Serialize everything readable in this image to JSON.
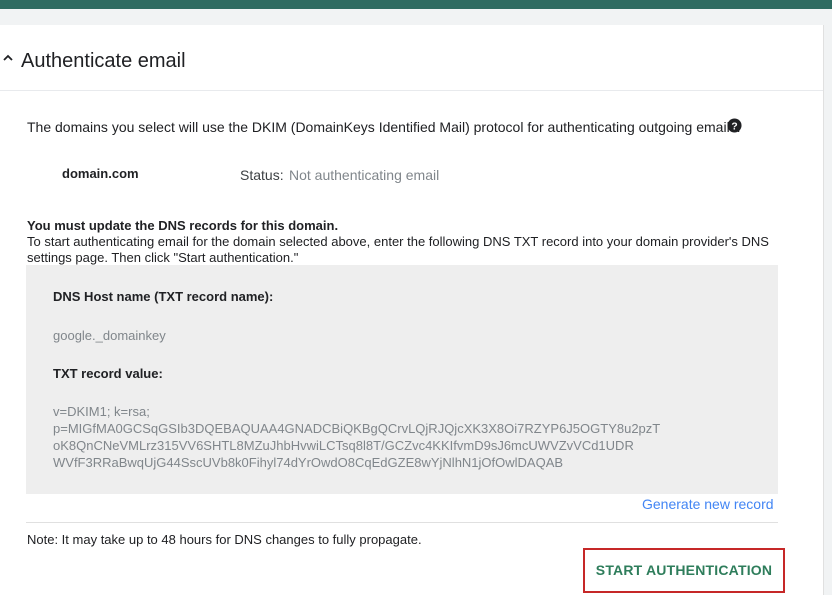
{
  "colors": {
    "top_bar": "#2f6b61",
    "accent_link": "#4285f4",
    "button_text": "#2e7d5b",
    "highlight_border": "#c62828",
    "record_box_bg": "#eeeeee",
    "muted_text": "#80868b"
  },
  "section": {
    "title": "Authenticate email",
    "expand_icon": "chevron-up-icon"
  },
  "intro": {
    "text": "The domains you select will use the DKIM (DomainKeys Identified Mail) protocol for authenticating outgoing emails.",
    "help_icon": "help-icon"
  },
  "domain_row": {
    "domain": "domain.com",
    "status_label": "Status:",
    "status_value": "Not authenticating email"
  },
  "dns": {
    "heading": "You must update the DNS records for this domain.",
    "instructions": "To start authenticating email for the domain selected above, enter the following DNS TXT record into your domain provider's DNS settings page. Then click \"Start authentication.\"",
    "host_label": "DNS Host name (TXT record name):",
    "host_value": "google._domainkey",
    "txt_label": "TXT record value:",
    "txt_lines": [
      "v=DKIM1; k=rsa;",
      "p=MIGfMA0GCSqGSIb3DQEBAQUAA4GNADCBiQKBgQCrvLQjRJQjcXK3X8Oi7RZYP6J5OGTY8u2pzT",
      "oK8QnCNeVMLrz315VV6SHTL8MZuJhbHvwiLCTsq8l8T/GCZvc4KKIfvmD9sJ6mcUWVZvVCd1UDR",
      "WVfF3RRaBwqUjG44SscUVb8k0Fihyl74dYrOwdO8CqEdGZE8wYjNlhN1jOfOwlDAQAB"
    ],
    "generate_link": "Generate new record"
  },
  "note": "Note: It may take up to 48 hours for DNS changes to fully propagate.",
  "actions": {
    "start_label": "START AUTHENTICATION"
  }
}
